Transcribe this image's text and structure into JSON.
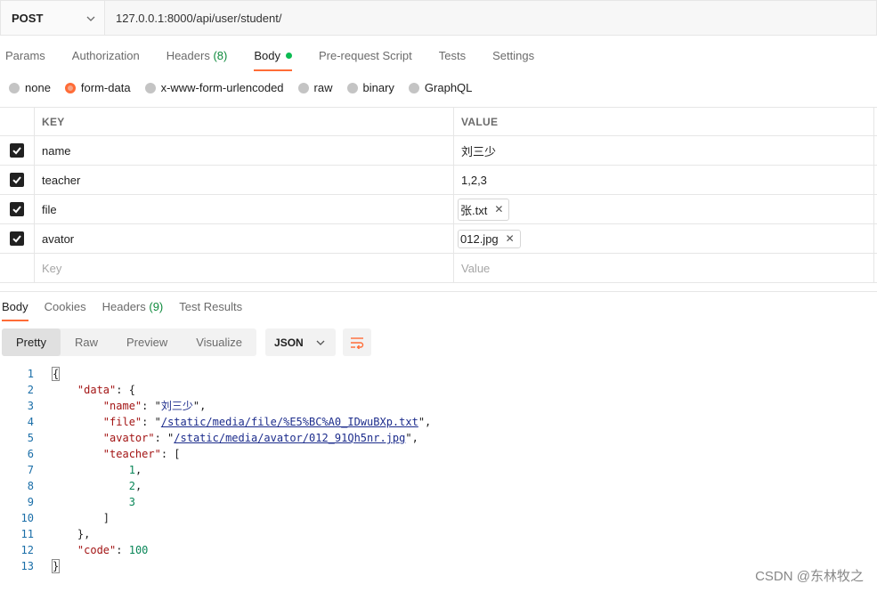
{
  "request": {
    "method": "POST",
    "url": "127.0.0.1:8000/api/user/student/"
  },
  "request_tabs": [
    {
      "label": "Params"
    },
    {
      "label": "Authorization"
    },
    {
      "label": "Headers",
      "count": "(8)"
    },
    {
      "label": "Body",
      "active": true
    },
    {
      "label": "Pre-request Script"
    },
    {
      "label": "Tests"
    },
    {
      "label": "Settings"
    }
  ],
  "body_types": [
    {
      "label": "none"
    },
    {
      "label": "form-data",
      "selected": true
    },
    {
      "label": "x-www-form-urlencoded"
    },
    {
      "label": "raw"
    },
    {
      "label": "binary"
    },
    {
      "label": "GraphQL"
    }
  ],
  "form_table": {
    "headers": {
      "key": "KEY",
      "value": "VALUE"
    },
    "rows": [
      {
        "key": "name",
        "value": "刘三少",
        "checked": true
      },
      {
        "key": "teacher",
        "value": "1,2,3",
        "checked": true
      },
      {
        "key": "file",
        "value": "张.txt",
        "checked": true,
        "is_file": true
      },
      {
        "key": "avator",
        "value": "012.jpg",
        "checked": true,
        "is_file": true
      }
    ],
    "placeholder": {
      "key": "Key",
      "value": "Value"
    }
  },
  "response_tabs": [
    {
      "label": "Body",
      "active": true
    },
    {
      "label": "Cookies"
    },
    {
      "label": "Headers",
      "count": "(9)"
    },
    {
      "label": "Test Results"
    }
  ],
  "view_modes": [
    "Pretty",
    "Raw",
    "Preview",
    "Visualize"
  ],
  "active_view": "Pretty",
  "format": "JSON",
  "code_lines": [
    {
      "n": "1",
      "text": "{"
    },
    {
      "n": "2",
      "text": "    \"data\": {"
    },
    {
      "n": "3",
      "text": "        \"name\": \"刘三少\","
    },
    {
      "n": "4",
      "text": "        \"file\": \"/static/media/file/%E5%BC%A0_IDwuBXp.txt\","
    },
    {
      "n": "5",
      "text": "        \"avator\": \"/static/media/avator/012_91Qh5nr.jpg\","
    },
    {
      "n": "6",
      "text": "        \"teacher\": ["
    },
    {
      "n": "7",
      "text": "            1,"
    },
    {
      "n": "8",
      "text": "            2,"
    },
    {
      "n": "9",
      "text": "            3"
    },
    {
      "n": "10",
      "text": "        ]"
    },
    {
      "n": "11",
      "text": "    },"
    },
    {
      "n": "12",
      "text": "    \"code\": 100"
    },
    {
      "n": "13",
      "text": "}"
    }
  ],
  "watermark": "CSDN @东林牧之",
  "colors": {
    "accent": "#ff6c37",
    "status_green": "#0cbb52",
    "count_green": "#0e8a3c"
  }
}
